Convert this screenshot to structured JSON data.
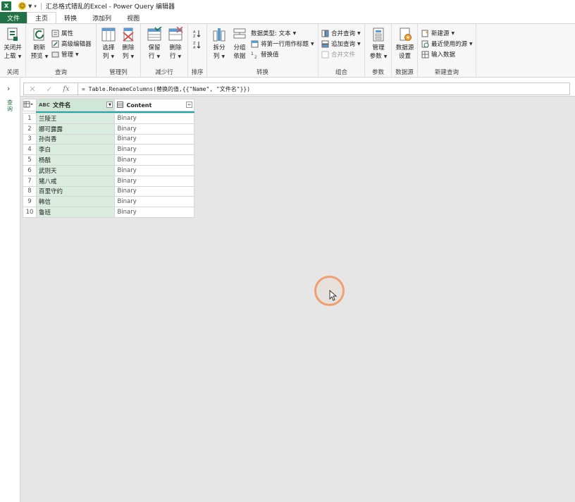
{
  "window": {
    "title": "汇总格式错乱的Excel - Power Query 编辑器",
    "app_icon": "excel-icon"
  },
  "tabs": [
    {
      "label": "文件"
    },
    {
      "label": "主页"
    },
    {
      "label": "转换"
    },
    {
      "label": "添加列"
    },
    {
      "label": "视图"
    }
  ],
  "ribbon": {
    "close": {
      "label": "关闭",
      "btn_line1": "关闭并",
      "btn_line2": "上载"
    },
    "query": {
      "label": "查询",
      "refresh_line1": "刷新",
      "refresh_line2": "预览",
      "properties": "属性",
      "advanced_editor": "高级编辑器",
      "manage": "管理"
    },
    "manage_cols": {
      "label": "管理列",
      "choose_line1": "选择",
      "choose_line2": "列",
      "remove_line1": "删除",
      "remove_line2": "列"
    },
    "reduce_rows": {
      "label": "减少行",
      "keep_line1": "保留",
      "keep_line2": "行",
      "remove_line1": "删除",
      "remove_line2": "行"
    },
    "sort": {
      "label": "排序"
    },
    "transform": {
      "label": "转换",
      "split_line1": "拆分",
      "split_line2": "列",
      "group_line1": "分组",
      "group_line2": "依据",
      "data_type": "数据类型: 文本",
      "first_row_header": "将第一行用作标题",
      "replace_values": "替换值"
    },
    "combine": {
      "label": "组合",
      "merge_queries": "合并查询",
      "append_queries": "追加查询",
      "combine_files": "合并文件"
    },
    "params": {
      "label": "参数",
      "manage_line1": "管理",
      "manage_line2": "参数"
    },
    "data_source": {
      "label": "数据源",
      "settings_line1": "数据源",
      "settings_line2": "设置"
    },
    "new_query": {
      "label": "新建查询",
      "new_source": "新建源",
      "recent_sources": "最近使用的源",
      "enter_data": "输入数据"
    }
  },
  "side_pane": {
    "label": "查询"
  },
  "formula_bar": {
    "formula": "= Table.RenameColumns(替换的值,{{\"Name\", \"文件名\"}})"
  },
  "table": {
    "columns": [
      {
        "type": "ABC",
        "name": "文件名"
      },
      {
        "type": "table",
        "name": "Content"
      }
    ],
    "rows": [
      {
        "n": "1",
        "name": "兰陵王",
        "content": "Binary"
      },
      {
        "n": "2",
        "name": "娜可露露",
        "content": "Binary"
      },
      {
        "n": "3",
        "name": "孙尚香",
        "content": "Binary"
      },
      {
        "n": "4",
        "name": "李白",
        "content": "Binary"
      },
      {
        "n": "5",
        "name": "杨戬",
        "content": "Binary"
      },
      {
        "n": "6",
        "name": "武则天",
        "content": "Binary"
      },
      {
        "n": "7",
        "name": "猪八戒",
        "content": "Binary"
      },
      {
        "n": "8",
        "name": "百里守约",
        "content": "Binary"
      },
      {
        "n": "9",
        "name": "韩信",
        "content": "Binary"
      },
      {
        "n": "10",
        "name": "鲁班",
        "content": "Binary"
      }
    ]
  },
  "colors": {
    "accent": "#217346",
    "selected_column": "#d9ecdf",
    "header_line": "#1fa7a7",
    "cursor_ring": "#f0a070"
  }
}
